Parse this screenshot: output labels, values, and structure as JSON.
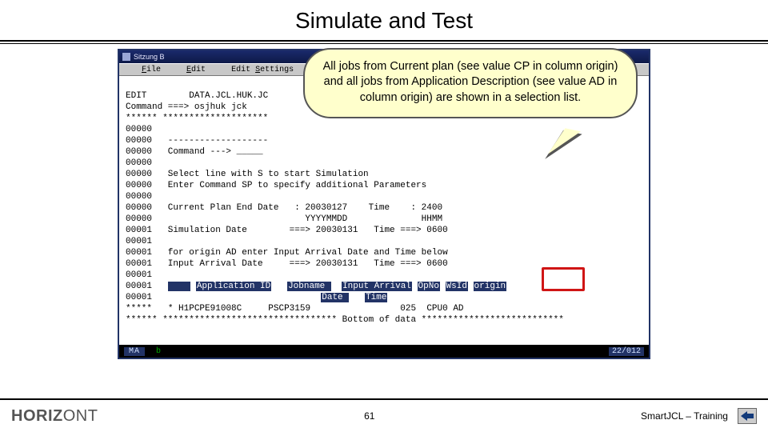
{
  "slide": {
    "title": "Simulate and Test",
    "page_number": "61",
    "brand_prefix": "HORIZ",
    "brand_suffix": "ONT",
    "product": "SmartJCL – Training"
  },
  "callout": {
    "text": "All jobs from Current plan (see value CP in column origin) and all jobs from Application Description (see value AD in column origin) are shown in a selection list."
  },
  "window": {
    "title_prefix": "Sitzung B",
    "menu": {
      "file": "File",
      "edit": "Edit",
      "settings": "Edit Settings"
    }
  },
  "terminal": {
    "l0": "EDIT        DATA.JCL.HUK.JC",
    "l1": "Command ===> osjhuk jck",
    "l2": "****** ********************",
    "l3_prefix": "00000",
    "l4": "00000   -------------------",
    "l5": "00000   Command ---> _____",
    "l6": "00000",
    "l7": "00000   Select line with S to start Simulation",
    "l8": "00000   Enter Command SP to specify additional Parameters",
    "l9": "00000",
    "l10": "00000   Current Plan End Date   : 20030127    Time    : 2400",
    "l11": "00000                             YYYYMMDD              HHMM",
    "l12": "00001   Simulation Date        ===> 20030131   Time ===> 0600",
    "l13": "00001",
    "l14": "00001   for origin AD enter Input Arrival Date and Time below",
    "l15": "00001   Input Arrival Date     ===> 20030131   Time ===> 0600",
    "l16": "00001",
    "hdr_sel": "    ",
    "hdr_app": "Application ID",
    "hdr_job": "Jobname ",
    "hdr_iad": "Input Arrival",
    "hdr_date": "Date ",
    "hdr_time": "Time",
    "hdr_op": "OpNo",
    "hdr_ws": "WsId",
    "hdr_orig": "origin",
    "row_sel": "*",
    "row_app": "H1PCPE91008C",
    "row_job": "PSCP3159",
    "row_op": "025",
    "row_ws": "CPU0",
    "row_orig": "AD",
    "bottom": "****** ********************************* Bottom of data ***************************"
  },
  "status": {
    "ma": "MA",
    "b": "b",
    "pos": "22/012"
  }
}
